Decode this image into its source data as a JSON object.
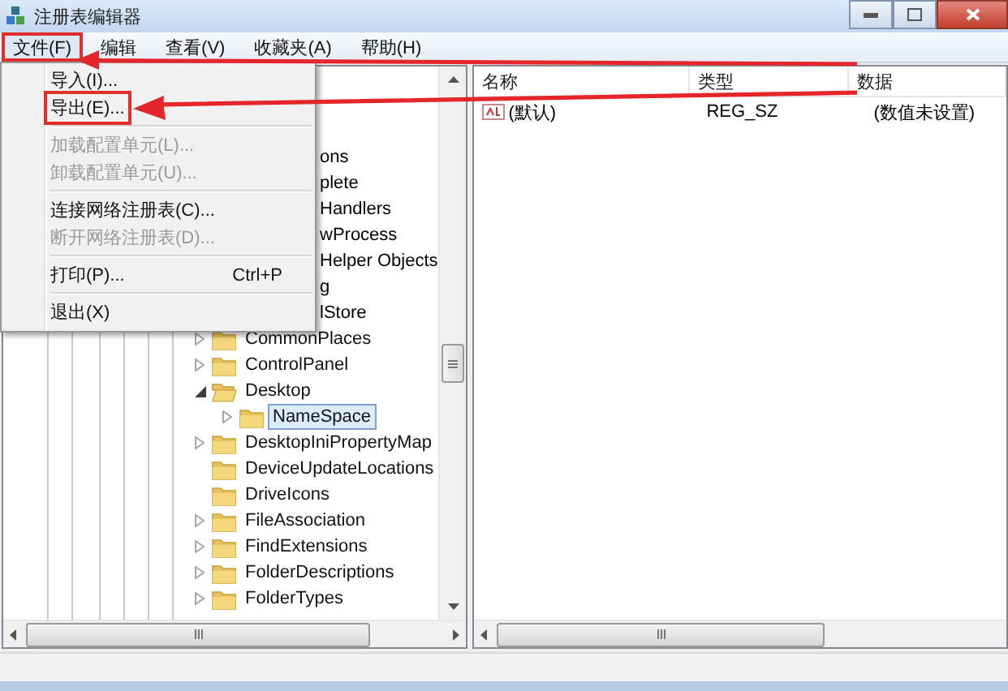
{
  "window": {
    "title": "注册表编辑器"
  },
  "menu_bar": [
    {
      "label": "文件(F)",
      "selected": true,
      "marked": true
    },
    {
      "label": "编辑",
      "selected": false,
      "marked": false
    },
    {
      "label": "查看(V)",
      "selected": false,
      "marked": false
    },
    {
      "label": "收藏夹(A)",
      "selected": false,
      "marked": false
    },
    {
      "label": "帮助(H)",
      "selected": false,
      "marked": false
    }
  ],
  "file_menu": [
    {
      "kind": "item",
      "label": "导入(I)...",
      "disabled": false,
      "marked": false
    },
    {
      "kind": "item",
      "label": "导出(E)...",
      "disabled": false,
      "marked": true
    },
    {
      "kind": "separator"
    },
    {
      "kind": "item",
      "label": "加载配置单元(L)...",
      "disabled": true,
      "marked": false
    },
    {
      "kind": "item",
      "label": "卸载配置单元(U)...",
      "disabled": true,
      "marked": false
    },
    {
      "kind": "separator"
    },
    {
      "kind": "item",
      "label": "连接网络注册表(C)...",
      "disabled": false,
      "marked": false
    },
    {
      "kind": "item",
      "label": "断开网络注册表(D)...",
      "disabled": true,
      "marked": false
    },
    {
      "kind": "separator"
    },
    {
      "kind": "item",
      "label": "打印(P)...",
      "shortcut": "Ctrl+P",
      "disabled": false,
      "marked": false
    },
    {
      "kind": "separator"
    },
    {
      "kind": "item",
      "label": "退出(X)",
      "disabled": false,
      "marked": false
    }
  ],
  "tree": {
    "covered_labels": [
      "ons",
      "plete",
      "Handlers",
      "wProcess",
      "Helper Objects",
      "g",
      "lStore"
    ],
    "items": [
      {
        "label": "CommonPlaces",
        "expandable": true,
        "expanded": false,
        "selected": false
      },
      {
        "label": "ControlPanel",
        "expandable": true,
        "expanded": false,
        "selected": false
      },
      {
        "label": "Desktop",
        "expandable": true,
        "expanded": true,
        "selected": false,
        "children": [
          {
            "label": "NameSpace",
            "expandable": true,
            "expanded": false,
            "selected": true
          }
        ]
      },
      {
        "label": "DesktopIniPropertyMap",
        "expandable": true,
        "expanded": false,
        "selected": false
      },
      {
        "label": "DeviceUpdateLocations",
        "expandable": false,
        "expanded": false,
        "selected": false
      },
      {
        "label": "DriveIcons",
        "expandable": false,
        "expanded": false,
        "selected": false
      },
      {
        "label": "FileAssociation",
        "expandable": true,
        "expanded": false,
        "selected": false
      },
      {
        "label": "FindExtensions",
        "expandable": true,
        "expanded": false,
        "selected": false
      },
      {
        "label": "FolderDescriptions",
        "expandable": true,
        "expanded": false,
        "selected": false
      },
      {
        "label": "FolderTypes",
        "expandable": true,
        "expanded": false,
        "selected": false
      }
    ]
  },
  "values": {
    "columns": [
      "名称",
      "类型",
      "数据"
    ],
    "rows": [
      {
        "name": "(默认)",
        "type": "REG_SZ",
        "data": "(数值未设置)"
      }
    ]
  }
}
